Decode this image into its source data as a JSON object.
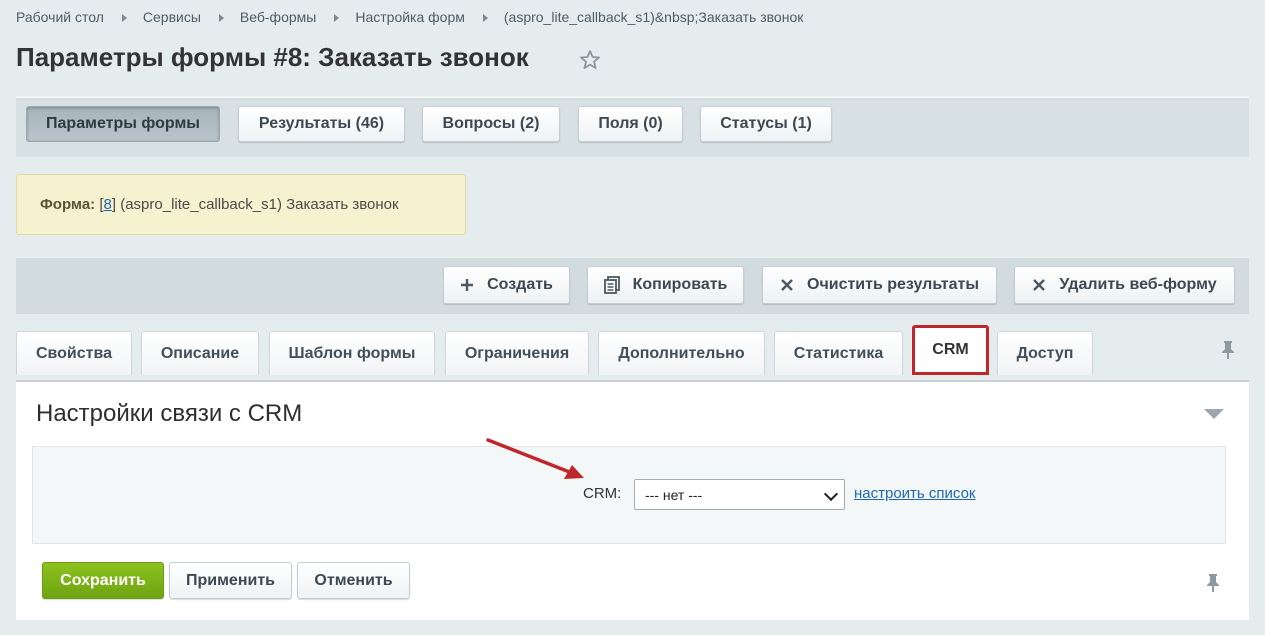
{
  "breadcrumb": [
    "Рабочий стол",
    "Сервисы",
    "Веб-формы",
    "Настройка форм",
    "(aspro_lite_callback_s1)&nbsp;Заказать звонок"
  ],
  "page_title": "Параметры формы #8: Заказать звонок",
  "top_tabs": [
    {
      "label": "Параметры формы",
      "active": true
    },
    {
      "label": "Результаты (46)"
    },
    {
      "label": "Вопросы (2)"
    },
    {
      "label": "Поля (0)"
    },
    {
      "label": "Статусы (1)"
    }
  ],
  "info": {
    "label": "Форма:",
    "id_link": "8",
    "text": "(aspro_lite_callback_s1) Заказать звонок"
  },
  "actions": [
    {
      "label": "Создать",
      "icon": "plus-icon"
    },
    {
      "label": "Копировать",
      "icon": "copy-icon"
    },
    {
      "label": "Очистить результаты",
      "icon": "close-icon"
    },
    {
      "label": "Удалить веб-форму",
      "icon": "close-icon"
    }
  ],
  "tabs": [
    {
      "label": "Свойства"
    },
    {
      "label": "Описание"
    },
    {
      "label": "Шаблон формы"
    },
    {
      "label": "Ограничения"
    },
    {
      "label": "Дополнительно"
    },
    {
      "label": "Статистика"
    },
    {
      "label": "CRM",
      "active": true
    },
    {
      "label": "Доступ"
    }
  ],
  "section": {
    "title": "Настройки связи с CRM",
    "crm_label": "CRM:",
    "crm_value": "--- нет ---",
    "config_link": "настроить список"
  },
  "buttons": {
    "save": "Сохранить",
    "apply": "Применить",
    "cancel": "Отменить"
  },
  "colors": {
    "accent_green": "#7ab317",
    "highlight_red": "#c0272d",
    "link_blue": "#2067b0"
  }
}
